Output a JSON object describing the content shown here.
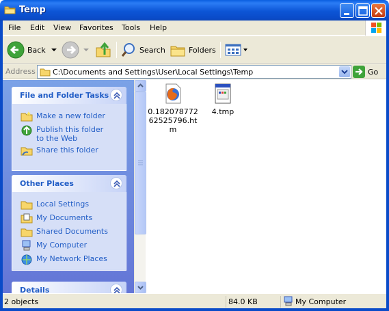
{
  "window": {
    "title": "Temp"
  },
  "menu": [
    "File",
    "Edit",
    "View",
    "Favorites",
    "Tools",
    "Help"
  ],
  "toolbar": {
    "back": "Back",
    "search": "Search",
    "folders": "Folders"
  },
  "address": {
    "label": "Address",
    "value": "C:\\Documents and Settings\\User\\Local Settings\\Temp",
    "go": "Go"
  },
  "panels": {
    "file_tasks": {
      "title": "File and Folder Tasks",
      "items": [
        "Make a new folder",
        "Publish this folder to the Web",
        "Share this folder"
      ]
    },
    "other_places": {
      "title": "Other Places",
      "items": [
        "Local Settings",
        "My Documents",
        "Shared Documents",
        "My Computer",
        "My Network Places"
      ]
    },
    "details": {
      "title": "Details"
    }
  },
  "files": [
    {
      "name": "0.18207877262525796.htm",
      "icon": "firefox-html-icon"
    },
    {
      "name": "4.tmp",
      "icon": "tmp-file-icon"
    }
  ],
  "status": {
    "objects": "2 objects",
    "size": "84.0 KB",
    "location": "My Computer"
  }
}
